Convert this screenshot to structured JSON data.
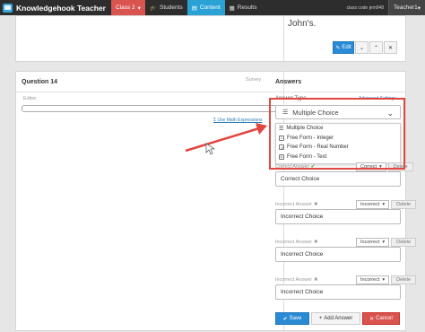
{
  "app": {
    "title": "Knowledgehook Teacher"
  },
  "nav": {
    "class_label": "Class 2",
    "students": "Students",
    "content": "Content",
    "results": "Results",
    "class_code": "class code jem948",
    "teacher": "Teacher1"
  },
  "top_panel": {
    "text": "John's."
  },
  "question": {
    "title": "Question 14",
    "tag": "Survey",
    "editor_label": "Editor",
    "math_link": "Use Math Expressions"
  },
  "answers": {
    "title": "Answers",
    "answer_type_label": "Answer Type",
    "advanced_link": "Advanced Settings",
    "selected_type": "Multiple Choice",
    "options": [
      "Multiple Choice",
      "Free Form - Integer",
      "Free Form - Real Number",
      "Free Form - Text"
    ],
    "items": [
      {
        "label": "Correct Answer",
        "value": "Correct Choice",
        "status": "Correct",
        "delete": "Delete"
      },
      {
        "label": "Incorrect Answer",
        "value": "Incorrect Choice",
        "status": "Incorrect",
        "delete": "Delete"
      },
      {
        "label": "Incorrect Answer",
        "value": "Incorrect Choice",
        "status": "Incorrect",
        "delete": "Delete"
      },
      {
        "label": "Incorrect Answer",
        "value": "Incorrect Choice",
        "status": "Incorrect",
        "delete": "Delete"
      }
    ],
    "save": "Save",
    "add": "Add Answer",
    "cancel": "Cancel"
  },
  "buttons": {
    "edit": "Edit"
  },
  "colors": {
    "accent": "#2aa2d6",
    "nav_active_class": "#d9534f",
    "highlight": "#e2463f",
    "primary": "#2a8ad4"
  }
}
